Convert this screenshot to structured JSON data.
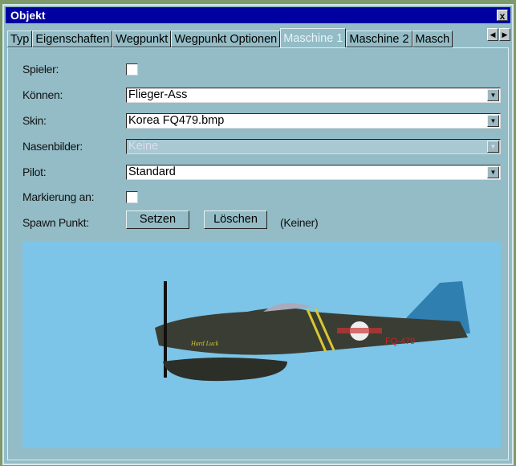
{
  "window": {
    "title": "Objekt",
    "close": "x"
  },
  "tabs": [
    "Typ",
    "Eigenschaften",
    "Wegpunkt",
    "Wegpunkt Optionen",
    "Maschine 1",
    "Maschine 2",
    "Masch"
  ],
  "active_tab": "Maschine 1",
  "form": {
    "spieler_label": "Spieler:",
    "koennen_label": "Können:",
    "koennen_value": "Flieger-Ass",
    "skin_label": "Skin:",
    "skin_value": "Korea FQ479.bmp",
    "nasen_label": "Nasenbilder:",
    "nasen_value": "Keine",
    "pilot_label": "Pilot:",
    "pilot_value": "Standard",
    "markierung_label": "Markierung an:",
    "spawn_label": "Spawn Punkt:",
    "setzen": "Setzen",
    "loeschen": "Löschen",
    "spawn_value": "(Keiner)"
  },
  "preview": {
    "tail_code": "FQ-479",
    "nose_art": "Hard Luck"
  }
}
